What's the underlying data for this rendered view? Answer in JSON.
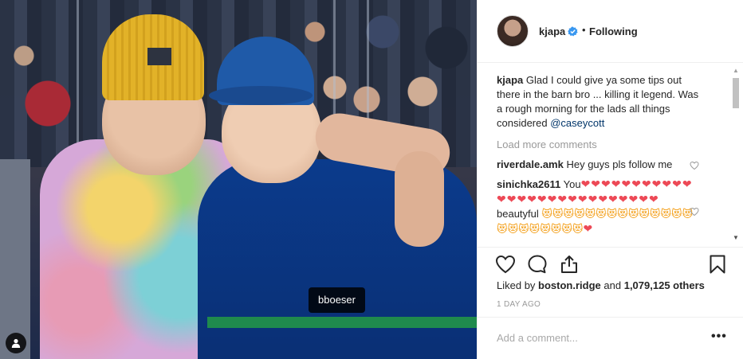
{
  "post": {
    "tag_label": "bboeser"
  },
  "header": {
    "username": "kjapa",
    "separator": "•",
    "follow_state": "Following"
  },
  "caption": {
    "username": "kjapa",
    "text": "Glad I could give ya some tips out there in the barn bro ... killing it legend. Was a rough morning for the lads all things considered",
    "mention": "@caseycott"
  },
  "load_more": "Load more comments",
  "comments": [
    {
      "username": "riverdale.amk",
      "text": "Hey guys pls follow me"
    },
    {
      "username": "sinichka2611",
      "text_before": "You",
      "hearts_line1": "❤❤❤❤❤❤❤❤❤❤❤❤❤❤❤❤❤❤❤❤❤",
      "hearts_line2": "❤❤❤❤❤❤",
      "text_after": "beautyful",
      "cats_line1": "😻😻😻",
      "cats_line2": "😻😻😻😻😻😻😻😻😻😻😻😻",
      "cats_line3": "😻😻😻😻😻😻😻",
      "end_heart": "❤"
    }
  ],
  "likes": {
    "prefix": "Liked by",
    "user": "boston.ridge",
    "middle": "and",
    "count": "1,079,125 others"
  },
  "date": "1 DAY AGO",
  "comment_input": {
    "placeholder": "Add a comment..."
  },
  "more_label": "•••",
  "icons": [
    "verified-badge-icon",
    "heart-icon",
    "comment-icon",
    "share-icon",
    "bookmark-icon",
    "user-tag-icon",
    "small-heart-icon"
  ],
  "colors": {
    "verified": "#3897f0",
    "mention": "#003569",
    "muted": "#999999",
    "heart_emoji": "#ed4956"
  }
}
